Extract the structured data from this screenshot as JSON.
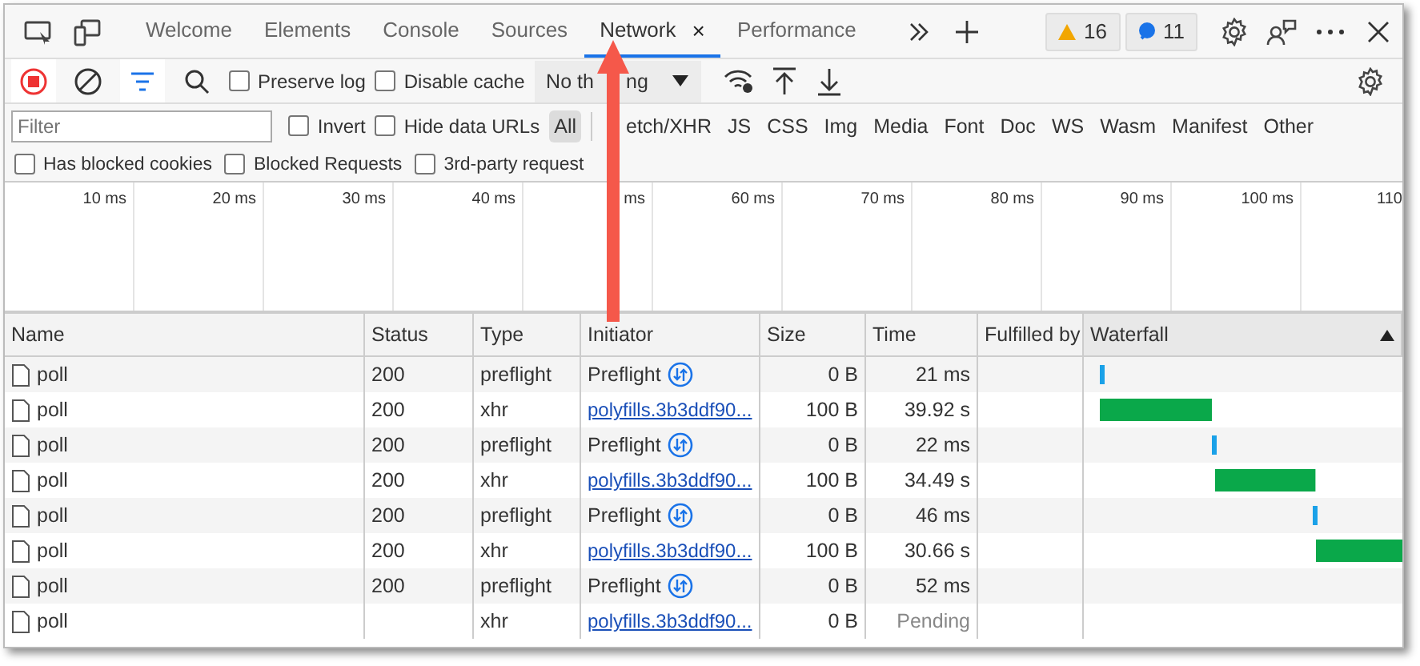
{
  "tabs": [
    {
      "label": "Welcome",
      "selected": false
    },
    {
      "label": "Elements",
      "selected": false
    },
    {
      "label": "Console",
      "selected": false
    },
    {
      "label": "Sources",
      "selected": false
    },
    {
      "label": "Network",
      "selected": true,
      "close": "×"
    },
    {
      "label": "Performance",
      "selected": false
    }
  ],
  "counters": [
    {
      "kind": "warning",
      "count": "16"
    },
    {
      "kind": "message",
      "count": "11"
    }
  ],
  "toolbar": {
    "recording": true,
    "filter_on": true,
    "checks": [
      {
        "label": "Preserve log",
        "checked": false
      },
      {
        "label": "Disable cache",
        "checked": false
      }
    ],
    "throttle_left": "No th",
    "throttle_right": "ng"
  },
  "filter": {
    "placeholder": "Filter",
    "checks": [
      {
        "label": "Invert",
        "checked": false
      },
      {
        "label": "Hide data URLs",
        "checked": false
      }
    ],
    "all": {
      "label": "All",
      "selected": true
    },
    "types": [
      {
        "label": "etch/XHR",
        "selected": false
      },
      {
        "label": "JS",
        "selected": false
      },
      {
        "label": "CSS",
        "selected": false
      },
      {
        "label": "Img",
        "selected": false
      },
      {
        "label": "Media",
        "selected": false
      },
      {
        "label": "Font",
        "selected": false
      },
      {
        "label": "Doc",
        "selected": false
      },
      {
        "label": "WS",
        "selected": false
      },
      {
        "label": "Wasm",
        "selected": false
      },
      {
        "label": "Manifest",
        "selected": false
      },
      {
        "label": "Other",
        "selected": false
      }
    ]
  },
  "more_checks": [
    {
      "label": "Has blocked cookies",
      "checked": false
    },
    {
      "label": "Blocked Requests",
      "checked": false
    },
    {
      "label": "3rd-party request",
      "checked": false
    }
  ],
  "timeline_ticks": [
    "10 ms",
    "20 ms",
    "30 ms",
    "40 ms",
    "ms",
    "60 ms",
    "70 ms",
    "80 ms",
    "90 ms",
    "100 ms",
    "110"
  ],
  "columns": [
    "Name",
    "Status",
    "Type",
    "Initiator",
    "Size",
    "Time",
    "Fulfilled by",
    "Waterfall"
  ],
  "rows": [
    {
      "name": "poll",
      "status": "200",
      "type": "preflight",
      "initiator": {
        "kind": "preflight",
        "text": "Preflight"
      },
      "size": "0 B",
      "time": "21 ms",
      "pending": false
    },
    {
      "name": "poll",
      "status": "200",
      "type": "xhr",
      "initiator": {
        "kind": "link",
        "text": "polyfills.3b3ddf90..."
      },
      "size": "100 B",
      "time": "39.92 s",
      "pending": false
    },
    {
      "name": "poll",
      "status": "200",
      "type": "preflight",
      "initiator": {
        "kind": "preflight",
        "text": "Preflight"
      },
      "size": "0 B",
      "time": "22 ms",
      "pending": false
    },
    {
      "name": "poll",
      "status": "200",
      "type": "xhr",
      "initiator": {
        "kind": "link",
        "text": "polyfills.3b3ddf90..."
      },
      "size": "100 B",
      "time": "34.49 s",
      "pending": false
    },
    {
      "name": "poll",
      "status": "200",
      "type": "preflight",
      "initiator": {
        "kind": "preflight",
        "text": "Preflight"
      },
      "size": "0 B",
      "time": "46 ms",
      "pending": false
    },
    {
      "name": "poll",
      "status": "200",
      "type": "xhr",
      "initiator": {
        "kind": "link",
        "text": "polyfills.3b3ddf90..."
      },
      "size": "100 B",
      "time": "30.66 s",
      "pending": false
    },
    {
      "name": "poll",
      "status": "200",
      "type": "preflight",
      "initiator": {
        "kind": "preflight",
        "text": "Preflight"
      },
      "size": "0 B",
      "time": "52 ms",
      "pending": false
    },
    {
      "name": "poll",
      "type": "xhr",
      "initiator": {
        "kind": "link",
        "text": "polyfills.3b3ddf90..."
      },
      "size": "0 B",
      "time": "Pending",
      "pending": true
    }
  ]
}
